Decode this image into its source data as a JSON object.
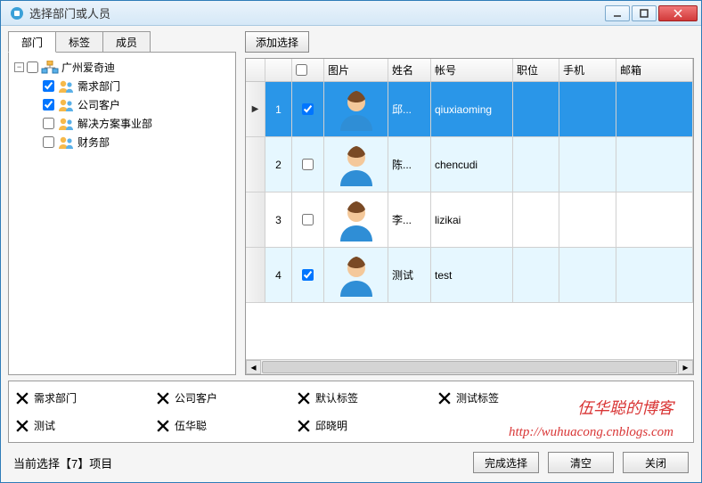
{
  "window": {
    "title": "选择部门或人员"
  },
  "tabs": {
    "dept": "部门",
    "tag": "标签",
    "member": "成员"
  },
  "tree": {
    "root": "广州爱奇迪",
    "children": [
      {
        "label": "需求部门",
        "checked": true
      },
      {
        "label": "公司客户",
        "checked": true
      },
      {
        "label": "解决方案事业部",
        "checked": false
      },
      {
        "label": "财务部",
        "checked": false
      }
    ]
  },
  "buttons": {
    "add": "添加选择",
    "finish": "完成选择",
    "clear": "清空",
    "close": "关闭"
  },
  "grid": {
    "headers": {
      "img": "图片",
      "name": "姓名",
      "account": "帐号",
      "position": "职位",
      "phone": "手机",
      "email": "邮箱"
    },
    "rows": [
      {
        "num": "1",
        "checked": true,
        "name": "邱...",
        "account": "qiuxiaoming",
        "selected": true
      },
      {
        "num": "2",
        "checked": false,
        "name": "陈...",
        "account": "chencudi",
        "alt": true
      },
      {
        "num": "3",
        "checked": false,
        "name": "李...",
        "account": "lizikai"
      },
      {
        "num": "4",
        "checked": true,
        "name": "测试",
        "account": "test",
        "alt": true
      }
    ]
  },
  "chips": [
    "需求部门",
    "公司客户",
    "默认标签",
    "测试标签",
    "测试",
    "伍华聪",
    "邱晓明"
  ],
  "watermark": {
    "line1": "伍华聪的博客",
    "line2": "http://wuhuacong.cnblogs.com"
  },
  "status": "当前选择【7】项目"
}
